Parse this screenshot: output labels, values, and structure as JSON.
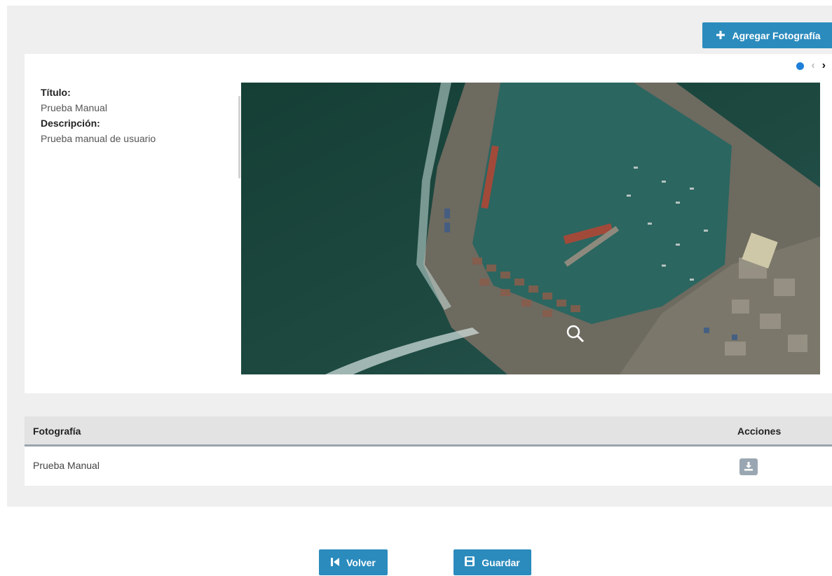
{
  "toolbar": {
    "add_photo_label": "Agregar Fotografía"
  },
  "viewer": {
    "title_label": "Título:",
    "title_value": "Prueba Manual",
    "description_label": "Descripción:",
    "description_value": "Prueba manual de usuario",
    "slide_count": 1,
    "active_slide": 1
  },
  "table": {
    "headers": {
      "photo": "Fotografía",
      "actions": "Acciones"
    },
    "rows": [
      {
        "photo": "Prueba Manual"
      }
    ]
  },
  "footer": {
    "back_label": "Volver",
    "save_label": "Guardar"
  },
  "colors": {
    "primary": "#2b8bbd",
    "dot_active": "#1e7fd8",
    "panel_bg": "#efefef",
    "action_icon_bg": "#9aa7b2"
  },
  "icons": {
    "add": "plus-icon",
    "prev": "chevron-left-icon",
    "next": "chevron-right-icon",
    "zoom": "magnifier-icon",
    "download": "download-icon",
    "back": "skip-back-icon",
    "save": "floppy-disk-icon"
  }
}
